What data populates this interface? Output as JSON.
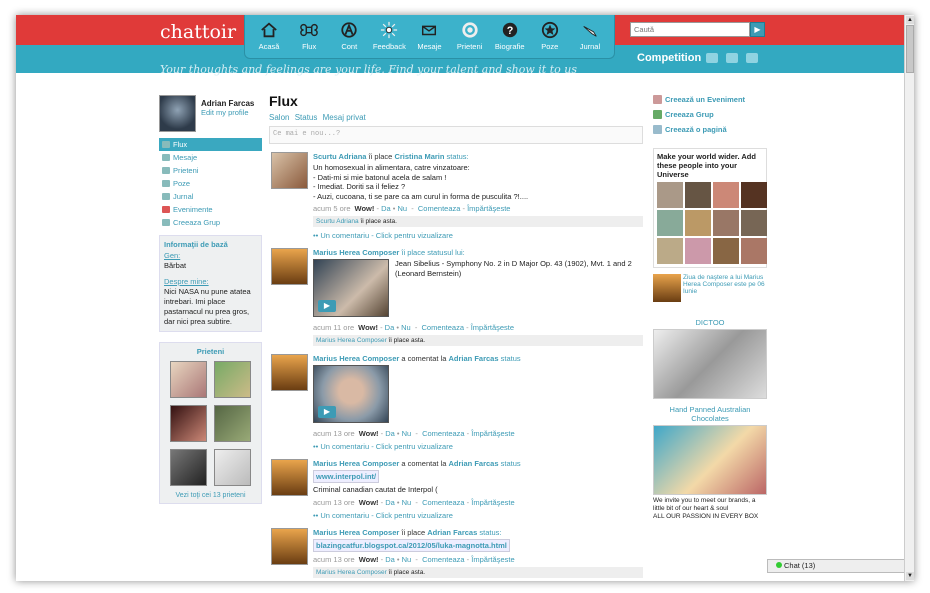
{
  "header": {
    "logo": "chattoir",
    "tagline": "Your thoughts and feelings are your life. Find your talent and show it to us",
    "search_placeholder": "Caută",
    "competition": "Competition"
  },
  "nav": [
    {
      "label": "Acasă",
      "icon": "home-icon"
    },
    {
      "label": "Flux",
      "icon": "command-icon"
    },
    {
      "label": "Cont",
      "icon": "account-icon"
    },
    {
      "label": "Feedback",
      "icon": "starburst-icon"
    },
    {
      "label": "Mesaje",
      "icon": "envelope-icon"
    },
    {
      "label": "Prieteni",
      "icon": "ring-icon"
    },
    {
      "label": "Biografie",
      "icon": "question-icon"
    },
    {
      "label": "Poze",
      "icon": "star-circle-icon"
    },
    {
      "label": "Jurnal",
      "icon": "pencil-icon"
    }
  ],
  "profile": {
    "name": "Adrian Farcas",
    "edit": "Edit my profile"
  },
  "menu": [
    "Flux",
    "Mesaje",
    "Prieteni",
    "Poze",
    "Jurnal",
    "Evenimente",
    "Creeaza Grup"
  ],
  "info": {
    "title": "Informaţii de bază",
    "gender_label": "Gen:",
    "gender": "Bărbat",
    "about_label": "Despre mine:",
    "about": "Nici NASA nu pune atatea intrebari. Imi place pastarnacul nu prea gros, dar nici prea subtire."
  },
  "friends": {
    "title": "Prieteni",
    "all": "Vezi toţi cei 13 prieteni"
  },
  "center": {
    "title": "Flux",
    "tabs": [
      "Salon",
      "Status",
      "Mesaj privat"
    ],
    "status_placeholder": "Ce mai e nou...?",
    "comment_link": "Un comentariu - Click pentru vizualizare",
    "like_suffix": "îi place asta.",
    "wow": "Wow!",
    "da": "Da",
    "nu": "Nu",
    "comenteaza": "Comenteaza",
    "imparteseste": "Împărtăşeste"
  },
  "posts": [
    {
      "author": "Scurtu Adriana",
      "action": "îi place",
      "target": "Cristina Marin",
      "tail": "status:",
      "lines": [
        "Un homosexual in alimentara, catre vinzatoare:",
        "- Dati-mi si mie batonul acela de salam !",
        "- Imediat. Doriti sa il feliez ?",
        "- Auzi, cucoana, ti se pare ca am curul in forma de pusculita ?!...."
      ],
      "time": "acum 5 ore",
      "liker": "Scurtu Adriana"
    },
    {
      "author": "Marius Herea Composer",
      "action": "îi place statusul lui:",
      "target": "",
      "tail": "",
      "video_caption": "Jean Sibelius - Symphony No. 2 in D Major Op. 43 (1902), Mvt. 1 and 2 (Leonard Bernstein)",
      "time": "acum 11 ore",
      "liker": "Marius Herea Composer"
    },
    {
      "author": "Marius Herea Composer",
      "action": "a comentat la",
      "target": "Adrian Farcas",
      "tail": "status",
      "time": "acum 13 ore"
    },
    {
      "author": "Marius Herea Composer",
      "action": "a comentat la",
      "target": "Adrian Farcas",
      "tail": "status",
      "link": "www.interpol.int/",
      "text": "Criminal canadian cautat de Interpol (",
      "time": "acum 13 ore"
    },
    {
      "author": "Marius Herea Composer",
      "action": "îi place",
      "target": "Adrian Farcas",
      "tail": "status:",
      "link": "blazingcatfur.blogspot.ca/2012/05/luka-magnotta.html",
      "time": "acum 13 ore",
      "liker": "Marius Herea Composer"
    }
  ],
  "right": {
    "links": [
      "Creează un Eveniment",
      "Creeaza Grup",
      "Creează o pagină"
    ],
    "promo": "Make your world wider. Add these people into your Universe",
    "bday": "Ziua de naştere a lui Marius Herea Composer este pe 06 Iunie",
    "ad1": "DICTOO",
    "ad2_title": "Hand Panned Australian Chocolates",
    "ad2_text1": "We invite you to meet our brands, a little bit of our heart & soul",
    "ad2_text2": "ALL OUR PASSION IN EVERY BOX"
  },
  "chat": "Chat (13)"
}
